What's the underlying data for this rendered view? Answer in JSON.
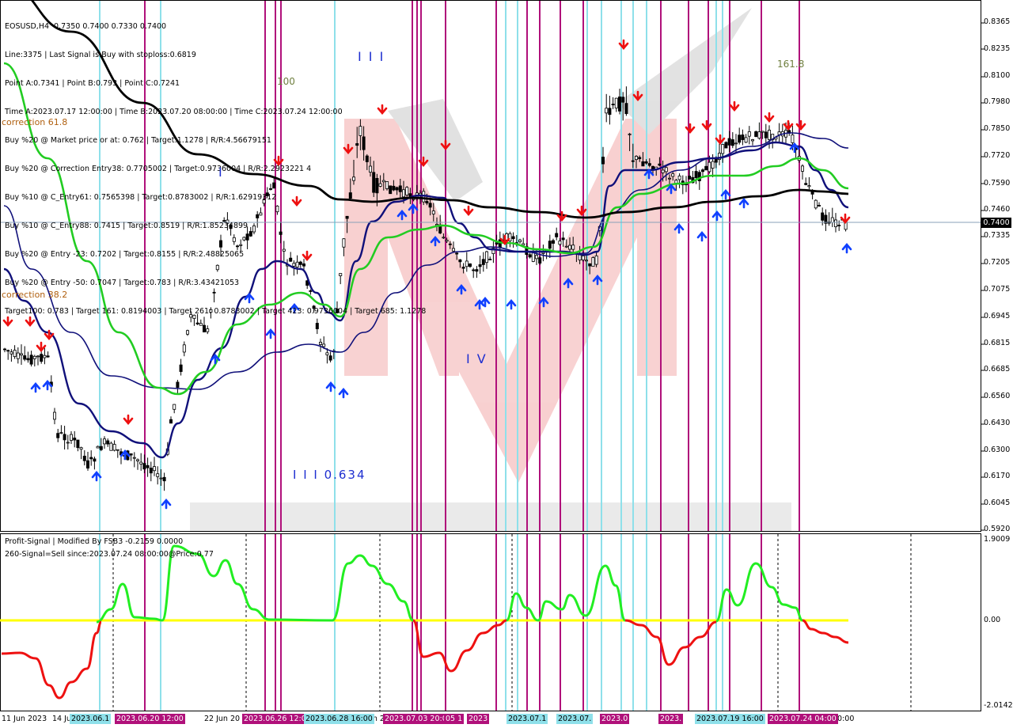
{
  "symbol_line": "EOSUSD,H4  0.7350 0.7400 0.7330 0.7400",
  "info_lines": [
    "Line:3375 | Last Signal is:Buy with stoploss:0.6819",
    "Point A:0.7341 | Point B:0.793 | Point C:0.7241",
    "Time A:2023.07.17 12:00:00 | Time B:2023.07.20 08:00:00 | Time C:2023.07.24 12:00:00",
    "Buy %20 @ Market price or at: 0.762 | Target:1.1278 | R/R:4.56679151",
    "Buy %20 @ Correction Entry38: 0.7705002 | Target:0.9736004 | R/R:2.2923221 4",
    "Buy %10 @ C_Entry61: 0.7565398 | Target:0.8783002 | R/R:1.62919312",
    "Buy %10 @ C_Entry88: 0.7415 | Target:0.8519 | R/R:1.85234899",
    "Buy %20 @ Entry -23: 0.7202 | Target:0.8155 | R/R:2.48825065",
    "Buy %20 @ Entry -50: 0.7047 | Target:0.783 | R/R:3.43421053",
    "Target100: 0.783 | Target 161: 0.8194003 | Target 261: 0.8783002 | Target 423: 0.9736004 | Target 685: 1.1278"
  ],
  "indicator": {
    "name": "Profit-Signal | Modified By FSB3 -0.2159 0.0000",
    "signal": "260-Signal=Sell since:2023.07.24 08:00:00@Price:0.77"
  },
  "price_axis": [
    "0.8365",
    "0.8235",
    "0.8100",
    "0.7980",
    "0.7850",
    "0.7720",
    "0.7590",
    "0.7460",
    "0.7335",
    "0.7205",
    "0.7075",
    "0.6945",
    "0.6815",
    "0.6685",
    "0.6560",
    "0.6430",
    "0.6300",
    "0.6170",
    "0.6045",
    "0.5920"
  ],
  "current_price": "0.7400",
  "indicator_axis": [
    "1.9009",
    "0.00",
    "-2.0142"
  ],
  "time_axis": [
    "11 Jun 2023",
    "14 Jun",
    "22 Jun 20",
    "Jun 2",
    "20:00"
  ],
  "time_boxes": [
    "2023.06.1",
    "2023.06.20 12:00",
    "2023.06.26 12:00",
    "2023.06.28 16:00",
    "2023.07.03 20:00",
    "05 1",
    "2023",
    "2023.07.1",
    "2023.07.",
    "2023.0",
    "2023.",
    "2023.07.19 16:00",
    "2023.07.24 04:00"
  ],
  "waves": {
    "w3": "I I I",
    "w1": "I",
    "w4": "I V",
    "w3b": "I I I 0.634"
  },
  "fib_labels": {
    "c618": "correction 61.8",
    "c382": "correction 38.2",
    "t100": "100",
    "t1618": "161.8"
  },
  "colors": {
    "ma_green": "#22cc22",
    "ma_navy": "#10107a",
    "ma_black": "#000000",
    "signal_green": "#22ee22",
    "signal_red": "#ee1111",
    "zero_line": "#ffff00",
    "magenta": "#b0107a",
    "cyan": "#8ee0ea",
    "up_arrow": "#1040ff",
    "down_arrow": "#ee1010"
  }
}
